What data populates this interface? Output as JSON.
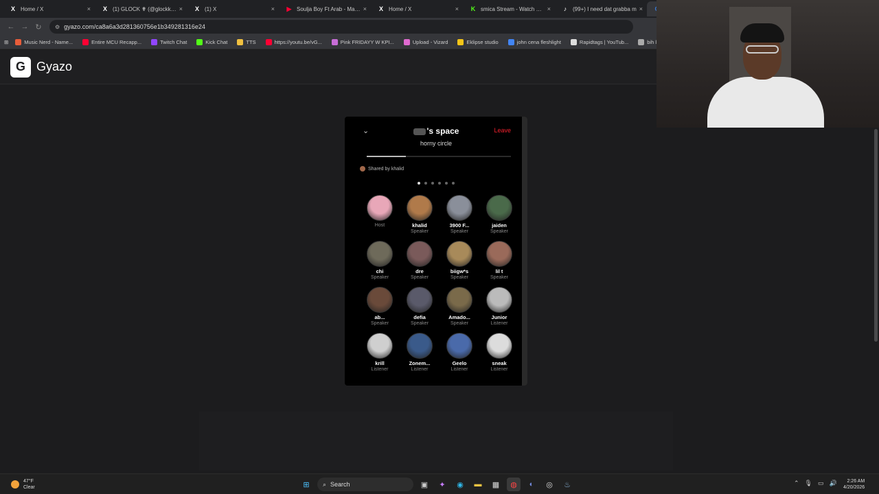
{
  "tabs": [
    {
      "title": "Home / X",
      "icon": "x-logo-icon",
      "color": "#ffffff"
    },
    {
      "title": "(1) GLOCK ✟ (@glockk1tty",
      "icon": "x-logo-icon",
      "color": "#ffffff"
    },
    {
      "title": "(1) X",
      "icon": "x-logo-icon",
      "color": "#ffffff"
    },
    {
      "title": "Soulja Boy Ft Arab - Mans",
      "icon": "youtube-icon",
      "color": "#ff0033"
    },
    {
      "title": "Home / X",
      "icon": "x-logo-icon",
      "color": "#ffffff"
    },
    {
      "title": "smica Stream - Watch Live",
      "icon": "kick-icon",
      "color": "#53fc18"
    },
    {
      "title": "(99+) I need dat grabba m",
      "icon": "tiktok-icon",
      "color": "#ffffff"
    },
    {
      "title": "Sc",
      "icon": "gyazo-icon",
      "color": "#3a7bd5"
    }
  ],
  "address": {
    "url": "gyazo.com/ca8a6a3d281360756e1b349281316e24"
  },
  "bookmarks": [
    {
      "label": "Music Nerd - Name...",
      "color": "#e85d3a"
    },
    {
      "label": "Entire MCU Recapp...",
      "color": "#ff0033"
    },
    {
      "label": "Twitch Chat",
      "color": "#9146ff"
    },
    {
      "label": "Kick Chat",
      "color": "#53fc18"
    },
    {
      "label": "TTS",
      "color": "#f0c040"
    },
    {
      "label": "https://youtu.be/vG...",
      "color": "#ff0033"
    },
    {
      "label": "Pink FRIDAYY W KPI...",
      "color": "#c86dd7"
    },
    {
      "label": "Upload - Vizard",
      "color": "#e06ad0"
    },
    {
      "label": "Eklipse studio",
      "color": "#f5c518"
    },
    {
      "label": "john cena fleshlight",
      "color": "#4285f4"
    },
    {
      "label": "Rapidtags | YouTub...",
      "color": "#dddddd"
    },
    {
      "label": "bih links",
      "color": "#aaaaaa"
    }
  ],
  "gyazo": {
    "logo_text": "Gyazo"
  },
  "space": {
    "title": "'s space",
    "subtitle": "horny circle",
    "leave_label": "Leave",
    "shared_by": "Shared by khalid",
    "progress": 0.27,
    "page_dots": 6,
    "active_dot": 0,
    "participants": [
      {
        "name": "",
        "role": "Host",
        "color": "#e8a7b8"
      },
      {
        "name": "khalid",
        "role": "Speaker",
        "color": "#b07a4a"
      },
      {
        "name": "3900 F...",
        "role": "Speaker",
        "color": "#8a8f9a"
      },
      {
        "name": "jaiden",
        "role": "Speaker",
        "color": "#4a6a4a"
      },
      {
        "name": "chi",
        "role": "Speaker",
        "color": "#6e6a5a"
      },
      {
        "name": "dre",
        "role": "Speaker",
        "color": "#7a5a5a"
      },
      {
        "name": "biigw*s",
        "role": "Speaker",
        "color": "#a88a5a"
      },
      {
        "name": "lil t",
        "role": "Speaker",
        "color": "#9a6a5a"
      },
      {
        "name": "ab...",
        "role": "Speaker",
        "color": "#6a4a3a"
      },
      {
        "name": "defia",
        "role": "Speaker",
        "color": "#5a5a6a"
      },
      {
        "name": "Amado...",
        "role": "Speaker",
        "color": "#7a6a4a"
      },
      {
        "name": "Junior",
        "role": "Listener",
        "color": "#bbbbbb"
      },
      {
        "name": "krill",
        "role": "Listener",
        "color": "#cfcfcf"
      },
      {
        "name": "Zonem...",
        "role": "Listener",
        "color": "#3a5a8a"
      },
      {
        "name": "Geelo",
        "role": "Listener",
        "color": "#4a6aaa"
      },
      {
        "name": "sneak",
        "role": "Listener",
        "color": "#dcdcdc"
      }
    ]
  },
  "taskbar": {
    "weather_temp": "47°F",
    "weather_desc": "Clear",
    "search_label": "Search",
    "time": "2:26 AM",
    "date": "4/20/2026"
  }
}
